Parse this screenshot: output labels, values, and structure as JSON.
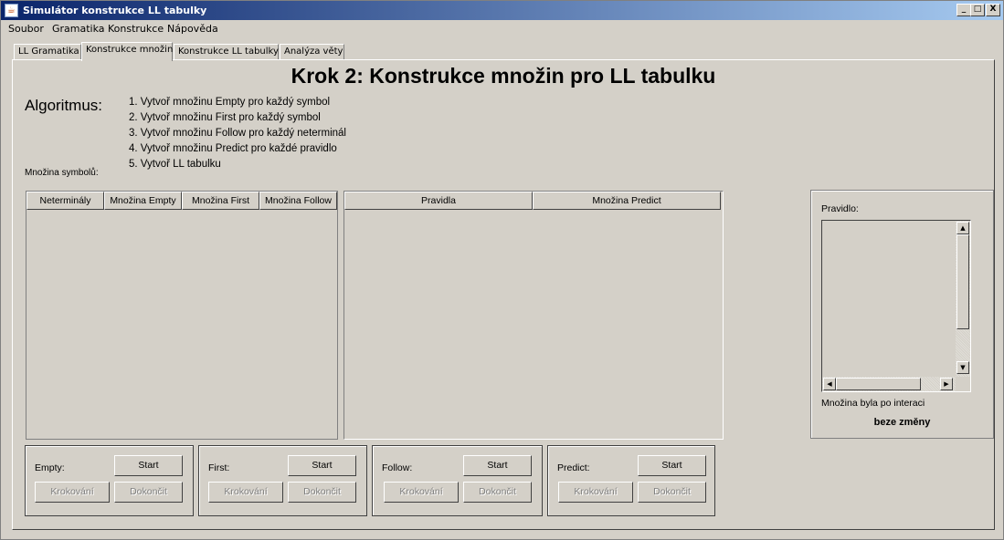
{
  "window": {
    "title": "Simulátor konstrukce LL tabulky",
    "minimize": "_",
    "maximize": "□",
    "close": "X"
  },
  "menu": [
    "Soubor",
    "Gramatika",
    "Konstrukce",
    "Nápověda"
  ],
  "tabs": [
    "LL Gramatika",
    "Konstrukce množin",
    "Konstrukce LL tabulky",
    "Analýza věty"
  ],
  "heading": "Krok 2: Konstrukce množin pro LL tabulku",
  "algorithm": {
    "label": "Algoritmus:",
    "steps": [
      "1. Vytvoř množinu Empty pro každý symbol",
      "2. Vytvoř množinu First pro každý symbol",
      "3. Vytvoř množinu Follow pro každý neterminál",
      "4. Vytvoř množinu Predict pro každé pravidlo",
      "5. Vytvoř LL tabulku"
    ]
  },
  "symbols_label": "Množina symbolů:",
  "sets_table": {
    "columns": [
      "Neterminály",
      "Množina Empty",
      "Množina First",
      "Množina Follow"
    ]
  },
  "predict_table": {
    "columns": [
      "Pravidla",
      "Množina Predict"
    ]
  },
  "rule_panel": {
    "label": "Pravidlo:",
    "info": "Množina byla po interaci",
    "status": "beze změny"
  },
  "controls": [
    {
      "label": "Empty:",
      "start": "Start",
      "step": "Krokování",
      "finish": "Dokončit"
    },
    {
      "label": "First:",
      "start": "Start",
      "step": "Krokování",
      "finish": "Dokončit"
    },
    {
      "label": "Follow:",
      "start": "Start",
      "step": "Krokování",
      "finish": "Dokončit"
    },
    {
      "label": "Predict:",
      "start": "Start",
      "step": "Krokování",
      "finish": "Dokončit"
    }
  ],
  "icons": {
    "app": "java-cup-icon",
    "scroll_up": "arrow-up-icon",
    "scroll_down": "arrow-down-icon",
    "scroll_left": "arrow-left-icon",
    "scroll_right": "arrow-right-icon"
  },
  "colors": {
    "titlebar_start": "#0a246a",
    "titlebar_end": "#a6caf0",
    "face": "#d4d0c8"
  }
}
